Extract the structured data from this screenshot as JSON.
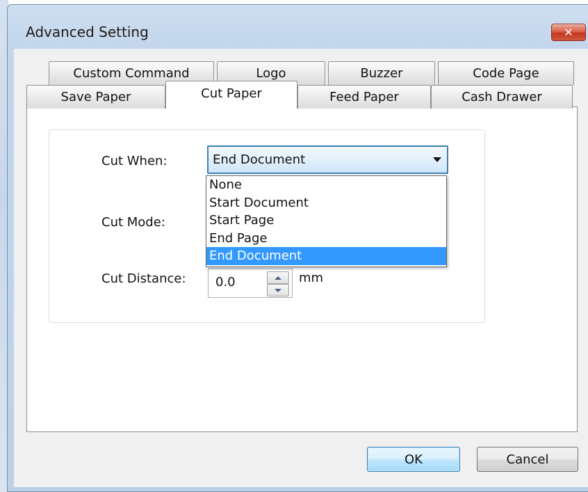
{
  "window": {
    "title": "Advanced Setting",
    "close_label": "✕"
  },
  "tabs": {
    "row1": [
      "Custom Command",
      "Logo",
      "Buzzer",
      "Code Page"
    ],
    "row2": [
      "Save Paper",
      "Cut Paper",
      "Feed Paper",
      "Cash Drawer"
    ],
    "active": "Cut Paper"
  },
  "form": {
    "cut_when_label": "Cut When:",
    "cut_when_value": "End Document",
    "cut_mode_label": "Cut Mode:",
    "cut_distance_label": "Cut Distance:",
    "cut_distance_value": "0.0",
    "cut_distance_unit": "mm"
  },
  "dropdown": {
    "options": [
      "None",
      "Start Document",
      "Start Page",
      "End Page",
      "End Document"
    ],
    "selected": "End Document"
  },
  "buttons": {
    "ok": "OK",
    "cancel": "Cancel"
  },
  "colors": {
    "selection": "#3399ff",
    "default_button_border": "#3c7fb1",
    "close_button": "#c4371f"
  }
}
